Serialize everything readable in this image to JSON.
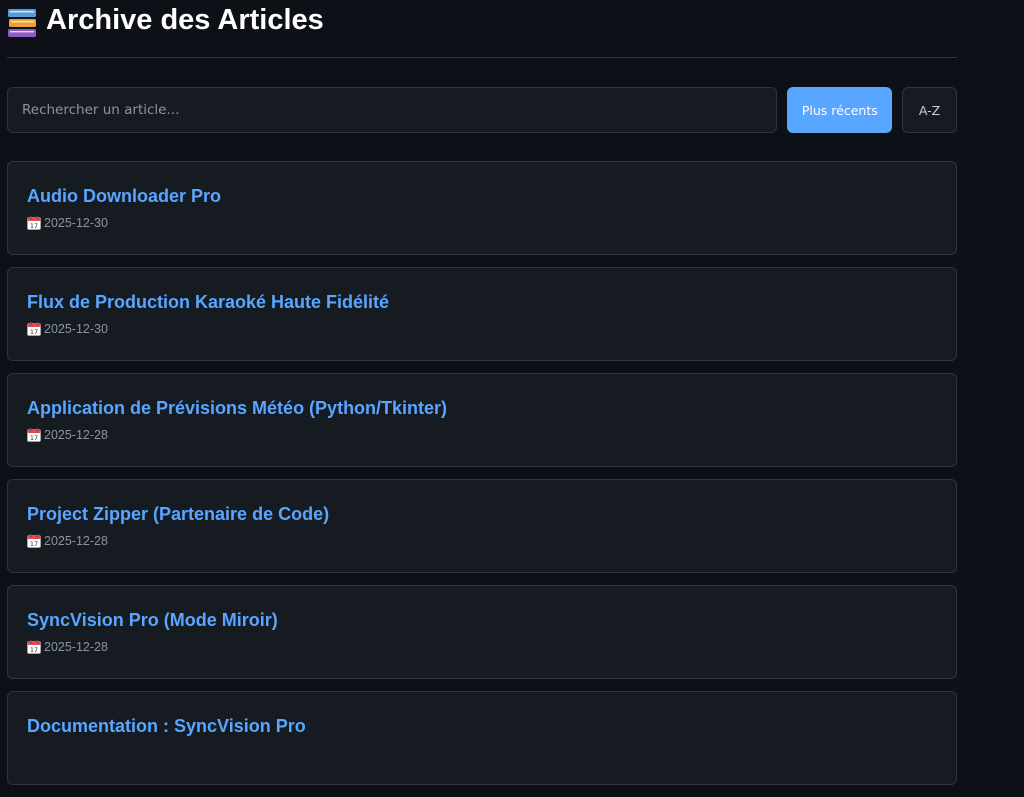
{
  "header": {
    "icon": "books-icon",
    "title": "Archive des Articles"
  },
  "search": {
    "placeholder": "Rechercher un article..."
  },
  "sort": {
    "recent_label": "Plus récents",
    "alpha_label": "A-Z"
  },
  "colors": {
    "background": "#0d1117",
    "card": "#161b22",
    "border": "#30363d",
    "accent": "#58a6ff"
  },
  "articles": [
    {
      "title": "Audio Downloader Pro",
      "date": "2025-12-30",
      "icon": "calendar-icon"
    },
    {
      "title": "Flux de Production Karaoké Haute Fidélité",
      "date": "2025-12-30",
      "icon": "calendar-icon"
    },
    {
      "title": "Application de Prévisions Météo (Python/Tkinter)",
      "date": "2025-12-28",
      "icon": "calendar-icon"
    },
    {
      "title": "Project Zipper (Partenaire de Code)",
      "date": "2025-12-28",
      "icon": "calendar-icon"
    },
    {
      "title": "SyncVision Pro (Mode Miroir)",
      "date": "2025-12-28",
      "icon": "calendar-icon"
    },
    {
      "title": "Documentation : SyncVision Pro",
      "date": "",
      "icon": "calendar-icon"
    }
  ]
}
